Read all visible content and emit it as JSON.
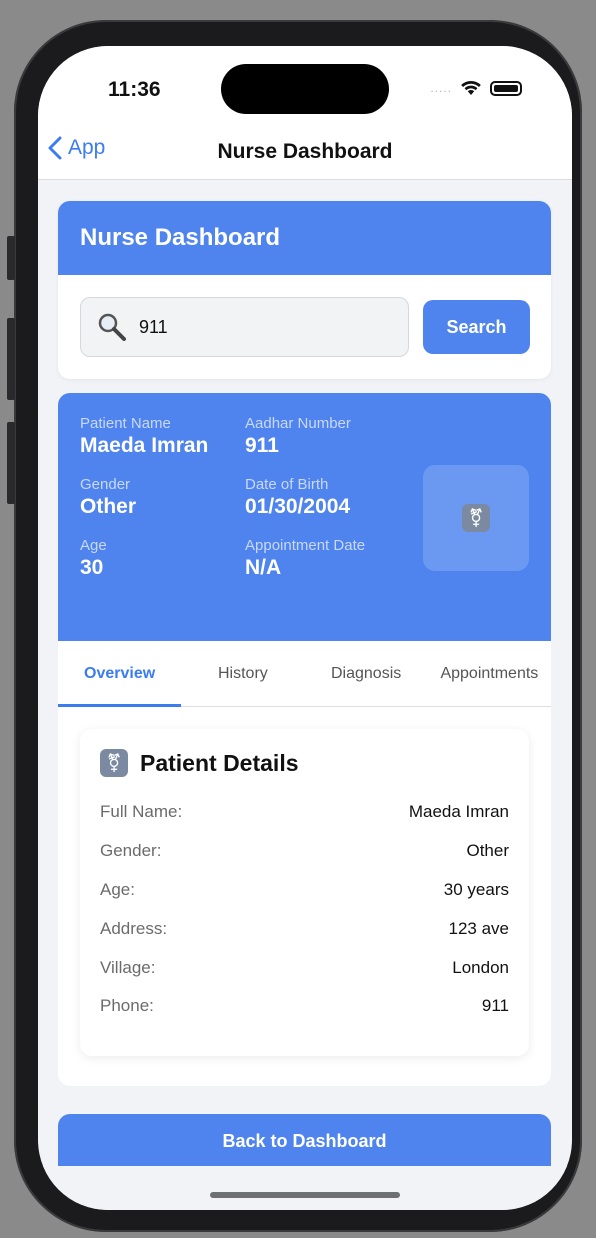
{
  "status_bar": {
    "time": "11:36",
    "dots": "....."
  },
  "nav": {
    "back_label": "App",
    "title": "Nurse Dashboard"
  },
  "search_card": {
    "header": "Nurse Dashboard",
    "input_value": "911",
    "button_label": "Search"
  },
  "patient": {
    "fields": [
      {
        "label": "Patient Name",
        "value": "Maeda Imran"
      },
      {
        "label": "Aadhar Number",
        "value": "911"
      },
      {
        "label": "Gender",
        "value": "Other"
      },
      {
        "label": "Date of Birth",
        "value": "01/30/2004"
      },
      {
        "label": "Age",
        "value": "30"
      },
      {
        "label": "Appointment Date",
        "value": "N/A"
      }
    ],
    "avatar_icon": "transgender-symbol-icon",
    "avatar_glyph": "⚧"
  },
  "tabs": [
    "Overview",
    "History",
    "Diagnosis",
    "Appointments"
  ],
  "active_tab": "Overview",
  "details": {
    "title": "Patient Details",
    "icon_glyph": "⚧",
    "rows": [
      {
        "label": "Full Name:",
        "value": "Maeda Imran"
      },
      {
        "label": "Gender:",
        "value": "Other"
      },
      {
        "label": "Age:",
        "value": "30 years"
      },
      {
        "label": "Address:",
        "value": "123 ave"
      },
      {
        "label": "Village:",
        "value": "London"
      },
      {
        "label": "Phone:",
        "value": "911"
      }
    ]
  },
  "footer": {
    "back_button": "Back to Dashboard"
  },
  "colors": {
    "accent": "#4f84ee",
    "link": "#3b7cf0",
    "background": "#f2f3f7"
  }
}
